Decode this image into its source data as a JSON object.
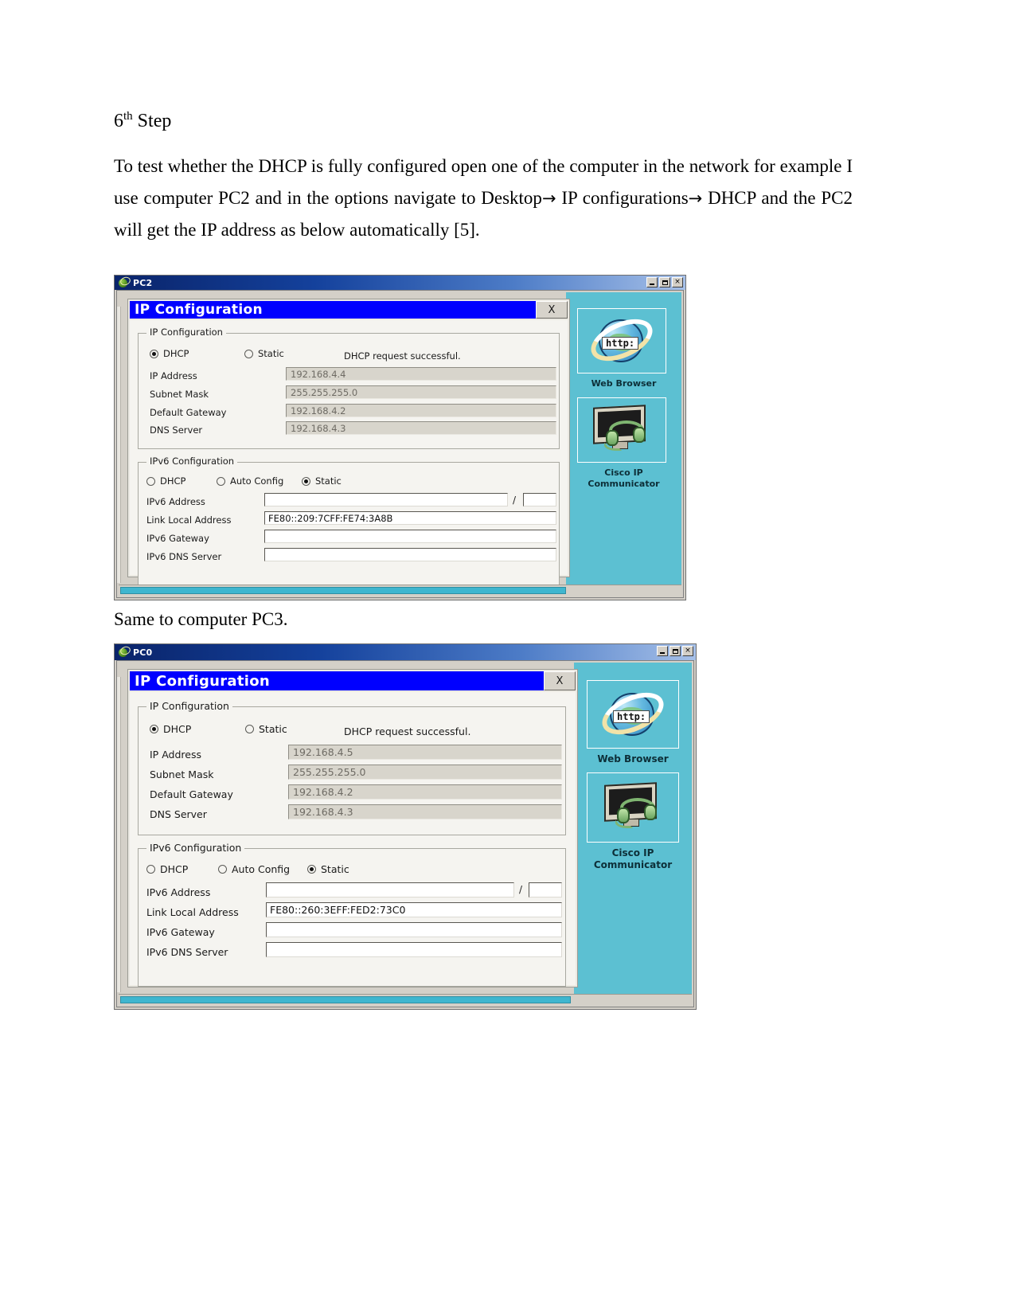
{
  "document": {
    "heading": "6",
    "heading_sup": "th",
    "heading_rest": " Step",
    "paragraph_1": "To test whether the DHCP is fully configured open one of the computer in the network for example I use computer PC2 and in the options navigate to Desktop",
    "arrow_1": "→",
    "paragraph_2": " IP configurations",
    "arrow_2": "→",
    "paragraph_3": " DHCP and the PC2 will get the IP address as below automatically [5].",
    "caption": "Same to computer PC3."
  },
  "window1": {
    "title": "PC2",
    "icon": "packet-tracer-globe-icon",
    "controls": {
      "minimize": "_",
      "maximize": "□",
      "close": "×"
    },
    "dialog": {
      "title": "IP Configuration",
      "close_label": "X",
      "ipv4": {
        "legend": "IP Configuration",
        "dhcp_label": "DHCP",
        "dhcp_selected": true,
        "static_label": "Static",
        "static_selected": false,
        "status": "DHCP request successful.",
        "fields": [
          {
            "label": "IP Address",
            "value": "192.168.4.4"
          },
          {
            "label": "Subnet Mask",
            "value": "255.255.255.0"
          },
          {
            "label": "Default Gateway",
            "value": "192.168.4.2"
          },
          {
            "label": "DNS Server",
            "value": "192.168.4.3"
          }
        ]
      },
      "ipv6": {
        "legend": "IPv6 Configuration",
        "dhcp_label": "DHCP",
        "dhcp_selected": false,
        "auto_label": "Auto Config",
        "auto_selected": false,
        "static_label": "Static",
        "static_selected": true,
        "slash": "/",
        "prefix_value": "",
        "fields": [
          {
            "label": "IPv6 Address",
            "value": ""
          },
          {
            "label": "Link Local Address",
            "value": "FE80::209:7CFF:FE74:3A8B"
          },
          {
            "label": "IPv6 Gateway",
            "value": ""
          },
          {
            "label": "IPv6 DNS Server",
            "value": ""
          }
        ]
      }
    },
    "desktop_icons": [
      {
        "name": "web-browser",
        "caption": "Web Browser",
        "glyph": "http:"
      },
      {
        "name": "cisco-ip-communicator",
        "caption": "Cisco IP\nCommunicator",
        "caption_line1": "Cisco IP",
        "caption_line2": "Communicator"
      }
    ]
  },
  "window2": {
    "title": "PC0",
    "icon": "packet-tracer-globe-icon",
    "controls": {
      "minimize": "_",
      "maximize": "□",
      "close": "×"
    },
    "dialog": {
      "title": "IP Configuration",
      "close_label": "X",
      "ipv4": {
        "legend": "IP Configuration",
        "dhcp_label": "DHCP",
        "dhcp_selected": true,
        "static_label": "Static",
        "static_selected": false,
        "status": "DHCP request successful.",
        "fields": [
          {
            "label": "IP Address",
            "value": "192.168.4.5"
          },
          {
            "label": "Subnet Mask",
            "value": "255.255.255.0"
          },
          {
            "label": "Default Gateway",
            "value": "192.168.4.2"
          },
          {
            "label": "DNS Server",
            "value": "192.168.4.3"
          }
        ]
      },
      "ipv6": {
        "legend": "IPv6 Configuration",
        "dhcp_label": "DHCP",
        "dhcp_selected": false,
        "auto_label": "Auto Config",
        "auto_selected": false,
        "static_label": "Static",
        "static_selected": true,
        "slash": "/",
        "prefix_value": "",
        "fields": [
          {
            "label": "IPv6 Address",
            "value": ""
          },
          {
            "label": "Link Local Address",
            "value": "FE80::260:3EFF:FED2:73C0"
          },
          {
            "label": "IPv6 Gateway",
            "value": ""
          },
          {
            "label": "IPv6 DNS Server",
            "value": ""
          }
        ]
      }
    },
    "desktop_icons": [
      {
        "name": "web-browser",
        "caption": "Web Browser",
        "glyph": "http:"
      },
      {
        "name": "cisco-ip-communicator",
        "caption_line1": "Cisco IP",
        "caption_line2": "Communicator"
      }
    ]
  },
  "colors": {
    "titlebar_blue": "#0a246a",
    "dialog_title_blue": "#0000ff",
    "desktop_panel_cyan": "#5cc0d2",
    "window_face": "#d4d0c8",
    "readonly_field": "#d8d5cc"
  }
}
